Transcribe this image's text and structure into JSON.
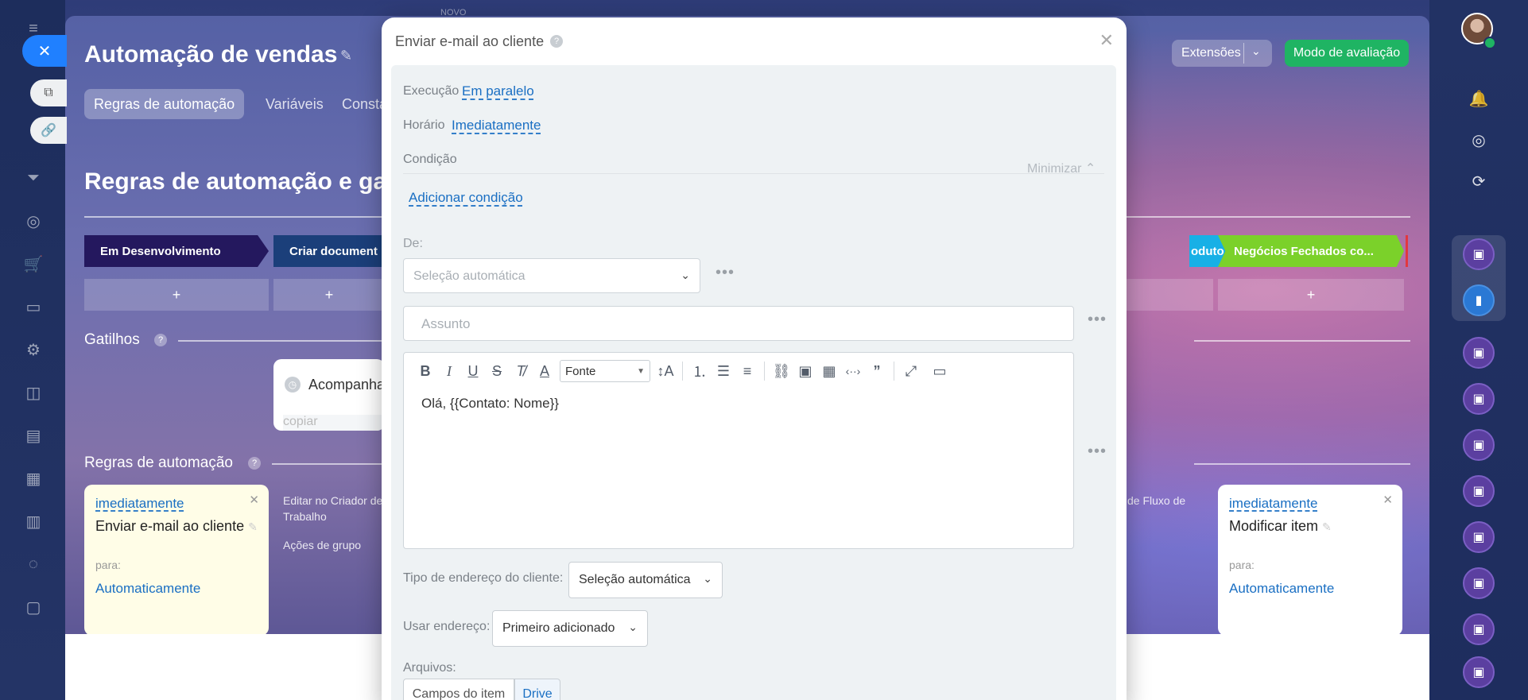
{
  "background": {
    "title": "Automação de vendas",
    "tabs": [
      "Regras de automação",
      "Variáveis",
      "Consta"
    ],
    "extensions_label": "Extensões",
    "eval_label": "Modo de avaliação",
    "section_title": "Regras de automação e ga",
    "stages": [
      {
        "label": "Em Desenvolvimento",
        "color": "#24185e"
      },
      {
        "label": "Criar document",
        "color": "#1b3f7a"
      },
      {
        "label": "oduto",
        "color": "#18b0e6"
      },
      {
        "label": "Negócios Fechados co...",
        "color": "#7bd12a"
      }
    ],
    "plus": "+",
    "triggers_label": "Gatilhos",
    "trigger_card": {
      "title": "Acompanha",
      "sub": "copiar"
    },
    "rules_label": "Regras de automação",
    "rule_cards": [
      {
        "when": "imediatamente",
        "title": "Enviar e-mail ao cliente",
        "to_label": "para:",
        "to": "Automaticamente"
      },
      {
        "when": "imediatamente",
        "title": "Modificar item",
        "to_label": "para:",
        "to": "Automaticamente"
      }
    ],
    "ghost_texts": [
      "Editar no Criador de",
      "Trabalho",
      "Ações de grupo",
      "de Fluxo de"
    ]
  },
  "modal": {
    "title": "Enviar e-mail ao cliente",
    "execution_label": "Execução",
    "execution_value": "Em paralelo",
    "time_label": "Horário",
    "time_value": "Imediatamente",
    "condition_label": "Condição",
    "minimize_label": "Minimizar",
    "add_condition": "Adicionar condição",
    "from_label": "De:",
    "from_placeholder": "Seleção automática",
    "subject_placeholder": "Assunto",
    "font_select": "Fonte",
    "editor_text": "Olá, {{Contato: Nome}}",
    "address_type_label": "Tipo de endereço do cliente:",
    "address_type_value": "Seleção automática",
    "use_address_label": "Usar endereço:",
    "use_address_value": "Primeiro adicionado",
    "files_label": "Arquivos:",
    "files_btn": "Campos do item",
    "drive_btn": "Drive"
  },
  "topbar_ghost": "NOVO"
}
